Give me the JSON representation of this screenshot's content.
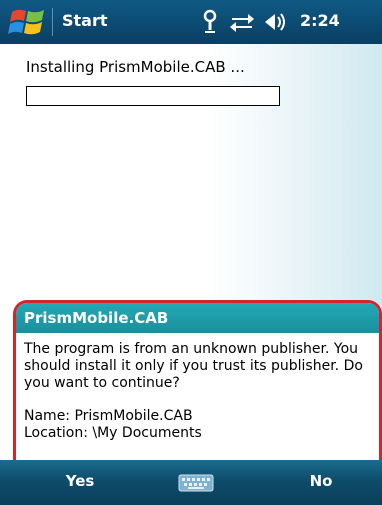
{
  "title_bar": {
    "start_label": "Start",
    "clock": "2:24",
    "icons": [
      "windows-flag-icon",
      "antenna-icon",
      "connectivity-arrows-icon",
      "speaker-icon"
    ]
  },
  "content": {
    "install_text": "Installing PrismMobile.CAB ...",
    "progress_fraction": 0.0
  },
  "dialog": {
    "title": "PrismMobile.CAB",
    "message": "The program is from an unknown publisher. You should install it only if you trust its publisher. Do you want to continue?",
    "name_line": "Name: PrismMobile.CAB",
    "location_line": "Location: \\My Documents"
  },
  "softkeys": {
    "left": "Yes",
    "right": "No",
    "center_icon": "keyboard-icon"
  },
  "colors": {
    "title_bar": "#0f5a84",
    "dialog_header": "#23a9b5",
    "dialog_border": "#d3262b",
    "softbar": "#0f4c6b"
  }
}
